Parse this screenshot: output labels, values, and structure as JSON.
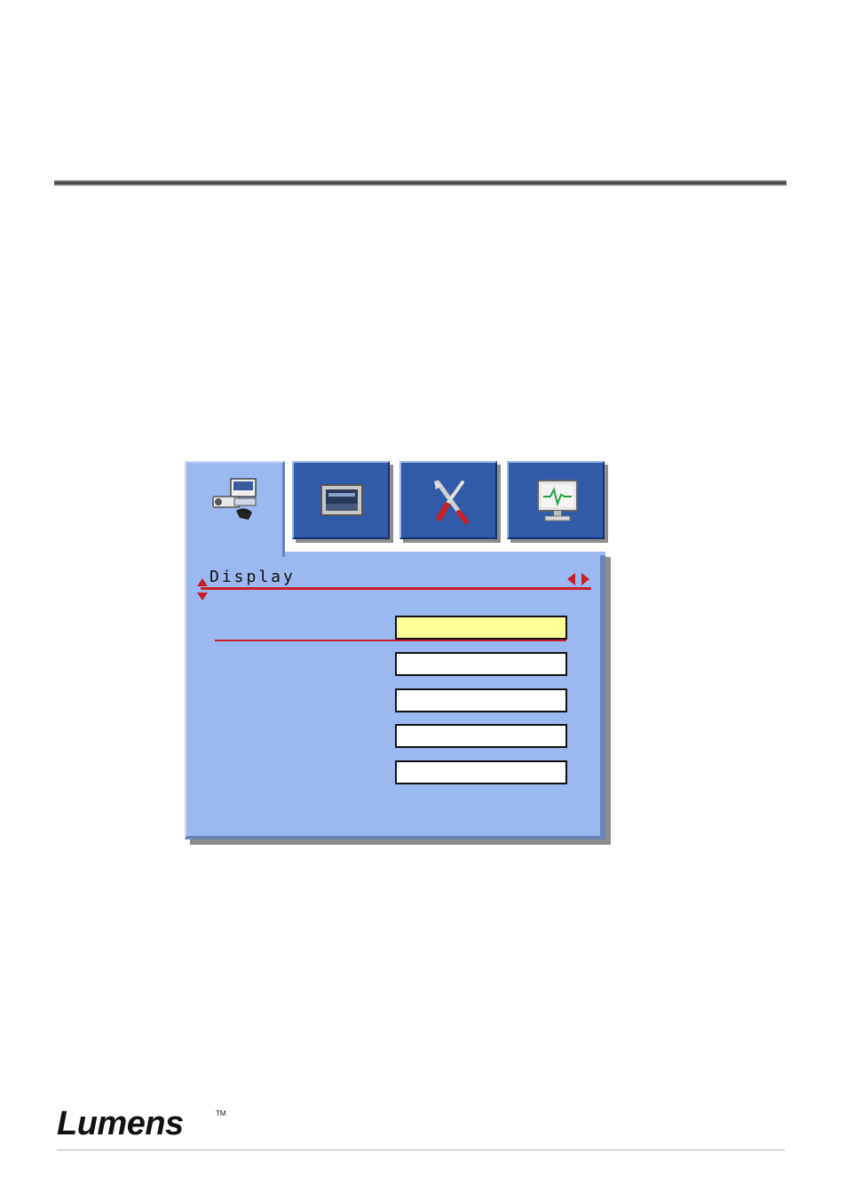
{
  "menu": {
    "section_title": "Display",
    "tabs": [
      {
        "icon": "camera-projector-icon",
        "active": true
      },
      {
        "icon": "display-screen-icon",
        "active": false
      },
      {
        "icon": "tools-icon",
        "active": false
      },
      {
        "icon": "monitor-signal-icon",
        "active": false
      }
    ],
    "fields": [
      {
        "value": "",
        "selected": true
      },
      {
        "value": "",
        "selected": false
      },
      {
        "value": "",
        "selected": false
      },
      {
        "value": "",
        "selected": false
      },
      {
        "value": "",
        "selected": false
      }
    ],
    "colors": {
      "panel": "#9cb8f0",
      "tab": "#2f5ba8",
      "accent": "#c8202a",
      "highlight": "#ffff99"
    }
  },
  "footer": {
    "brand": "Lumens",
    "trademark": "TM"
  }
}
